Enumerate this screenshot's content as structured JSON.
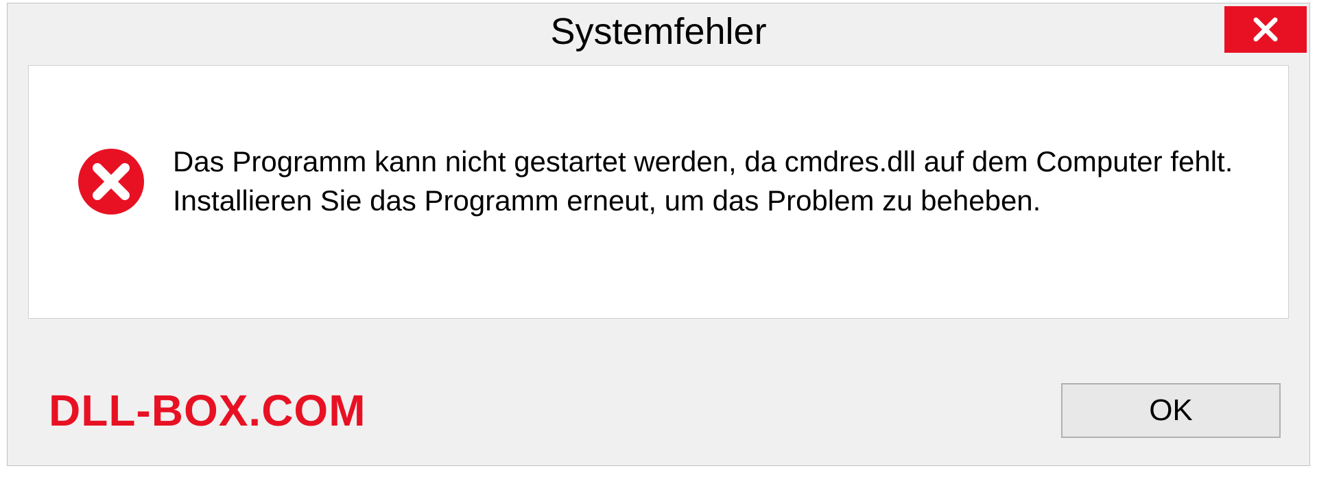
{
  "dialog": {
    "title": "Systemfehler",
    "message": "Das Programm kann nicht gestartet werden, da cmdres.dll auf dem Computer fehlt. Installieren Sie das Programm erneut, um das Problem zu beheben.",
    "ok_label": "OK",
    "watermark": "DLL-BOX.COM"
  }
}
